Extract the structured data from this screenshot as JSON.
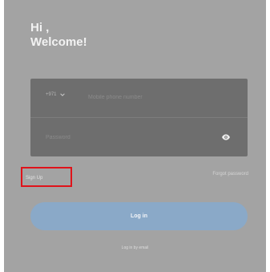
{
  "greeting": {
    "line1": "Hi ,",
    "line2": "Welcome!"
  },
  "form": {
    "country_code": "+971",
    "phone_placeholder": "Mobile phone number",
    "password_placeholder": "Password",
    "password_toggle_icon": "eye-icon"
  },
  "links": {
    "sign_up": "Sign Up",
    "forgot_password": "Forgot password"
  },
  "login_button": {
    "label": "Log in",
    "color": "#8aa9c8"
  },
  "email_login": "Log in by email",
  "colors": {
    "background": "#a3a3a3",
    "form_box": "#6e6e6e",
    "highlight": "#e0131a"
  }
}
